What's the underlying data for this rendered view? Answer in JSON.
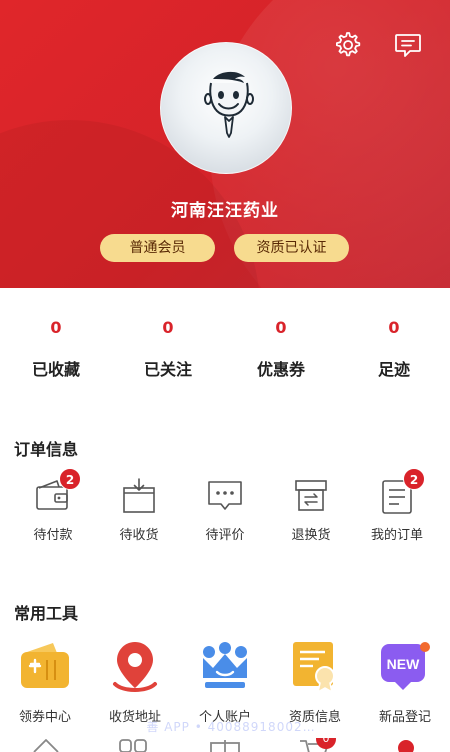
{
  "profile": {
    "company_name": "河南汪汪药业",
    "member_level": "普通会员",
    "certification": "资质已认证"
  },
  "header": {
    "settings_icon": "gear-icon",
    "message_icon": "message-icon"
  },
  "stats": [
    {
      "value": "0",
      "label": "已收藏"
    },
    {
      "value": "0",
      "label": "已关注"
    },
    {
      "value": "0",
      "label": "优惠券"
    },
    {
      "value": "0",
      "label": "足迹"
    }
  ],
  "orders": {
    "title": "订单信息",
    "items": [
      {
        "label": "待付款",
        "icon": "wallet-icon",
        "count": "2"
      },
      {
        "label": "待收货",
        "icon": "package-icon",
        "count": ""
      },
      {
        "label": "待评价",
        "icon": "comment-icon",
        "count": ""
      },
      {
        "label": "退换货",
        "icon": "return-icon",
        "count": ""
      },
      {
        "label": "我的订单",
        "icon": "order-list-icon",
        "count": "2"
      }
    ]
  },
  "tools": {
    "title": "常用工具",
    "items": [
      {
        "label": "领券中心",
        "icon": "coupon-wallet-icon"
      },
      {
        "label": "收货地址",
        "icon": "location-pin-icon"
      },
      {
        "label": "个人账户",
        "icon": "crown-account-icon"
      },
      {
        "label": "资质信息",
        "icon": "certificate-icon"
      },
      {
        "label": "新品登记",
        "icon": "new-badge-icon",
        "icon_text": "NEW"
      }
    ]
  },
  "watermark": "善 APP • 40088918002…",
  "tabbar": {
    "cart_badge": "0"
  },
  "colors": {
    "brand_red": "#d9232a",
    "badge_gold": "#f7db8f",
    "tool_orange": "#f2b431",
    "tool_red": "#e0423a",
    "tool_blue": "#4a8de8",
    "tool_purple": "#8b5cf0"
  }
}
